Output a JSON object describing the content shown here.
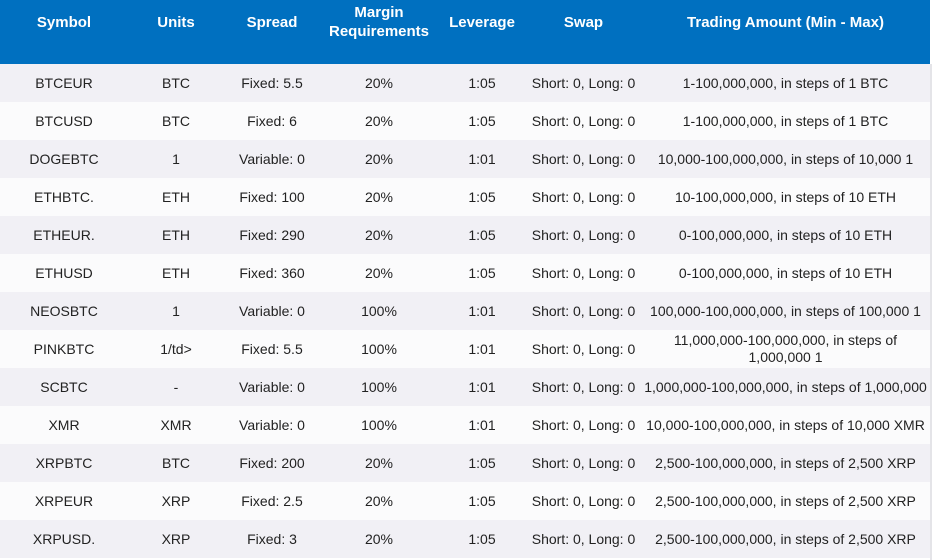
{
  "table": {
    "header_color": "#0070c0",
    "columns": [
      {
        "key": "symbol",
        "label": "Symbol"
      },
      {
        "key": "units",
        "label": "Units"
      },
      {
        "key": "spread",
        "label": "Spread"
      },
      {
        "key": "margin",
        "label": "Margin Requirements"
      },
      {
        "key": "leverage",
        "label": "Leverage"
      },
      {
        "key": "swap",
        "label": "Swap"
      },
      {
        "key": "amount",
        "label": "Trading Amount (Min - Max)"
      }
    ],
    "rows": [
      {
        "symbol": "BTCEUR",
        "units": "BTC",
        "spread": "Fixed: 5.5",
        "margin": "20%",
        "leverage": "1:05",
        "swap": "Short: 0, Long: 0",
        "amount": "1-100,000,000, in steps of 1 BTC"
      },
      {
        "symbol": "BTCUSD",
        "units": "BTC",
        "spread": "Fixed: 6",
        "margin": "20%",
        "leverage": "1:05",
        "swap": "Short: 0, Long: 0",
        "amount": "1-100,000,000, in steps of 1 BTC"
      },
      {
        "symbol": "DOGEBTC",
        "units": "1",
        "spread": "Variable: 0",
        "margin": "20%",
        "leverage": "1:01",
        "swap": "Short: 0, Long: 0",
        "amount": "10,000-100,000,000, in steps of 10,000 1"
      },
      {
        "symbol": "ETHBTC.",
        "units": "ETH",
        "spread": "Fixed: 100",
        "margin": "20%",
        "leverage": "1:05",
        "swap": "Short: 0, Long: 0",
        "amount": "10-100,000,000, in steps of 10 ETH"
      },
      {
        "symbol": "ETHEUR.",
        "units": "ETH",
        "spread": "Fixed: 290",
        "margin": "20%",
        "leverage": "1:05",
        "swap": "Short: 0, Long: 0",
        "amount": "0-100,000,000, in steps of 10 ETH"
      },
      {
        "symbol": "ETHUSD",
        "units": "ETH",
        "spread": "Fixed: 360",
        "margin": "20%",
        "leverage": "1:05",
        "swap": "Short: 0, Long: 0",
        "amount": "0-100,000,000, in steps of 10 ETH"
      },
      {
        "symbol": "NEOSBTC",
        "units": "1",
        "spread": "Variable: 0",
        "margin": "100%",
        "leverage": "1:01",
        "swap": "Short: 0, Long: 0",
        "amount": "100,000-100,000,000, in steps of 100,000 1"
      },
      {
        "symbol": "PINKBTC",
        "units": "1/td>",
        "spread": "Fixed: 5.5",
        "margin": "100%",
        "leverage": "1:01",
        "swap": "Short: 0, Long: 0",
        "amount": "11,000,000-100,000,000, in steps of 1,000,000 1"
      },
      {
        "symbol": "SCBTC",
        "units": "-",
        "spread": "Variable: 0",
        "margin": "100%",
        "leverage": "1:01",
        "swap": "Short: 0, Long: 0",
        "amount": "1,000,000-100,000,000, in steps of 1,000,000"
      },
      {
        "symbol": "XMR",
        "units": "XMR",
        "spread": "Variable: 0",
        "margin": "100%",
        "leverage": "1:01",
        "swap": "Short: 0, Long: 0",
        "amount": "10,000-100,000,000, in steps of 10,000 XMR"
      },
      {
        "symbol": "XRPBTC",
        "units": "BTC",
        "spread": "Fixed: 200",
        "margin": "20%",
        "leverage": "1:05",
        "swap": "Short: 0, Long: 0",
        "amount": "2,500-100,000,000, in steps of 2,500 XRP"
      },
      {
        "symbol": "XRPEUR",
        "units": "XRP",
        "spread": "Fixed: 2.5",
        "margin": "20%",
        "leverage": "1:05",
        "swap": "Short: 0, Long: 0",
        "amount": "2,500-100,000,000, in steps of 2,500 XRP"
      },
      {
        "symbol": "XRPUSD.",
        "units": "XRP",
        "spread": "Fixed: 3",
        "margin": "20%",
        "leverage": "1:05",
        "swap": "Short: 0, Long: 0",
        "amount": "2,500-100,000,000, in steps of 2,500 XRP"
      }
    ]
  }
}
